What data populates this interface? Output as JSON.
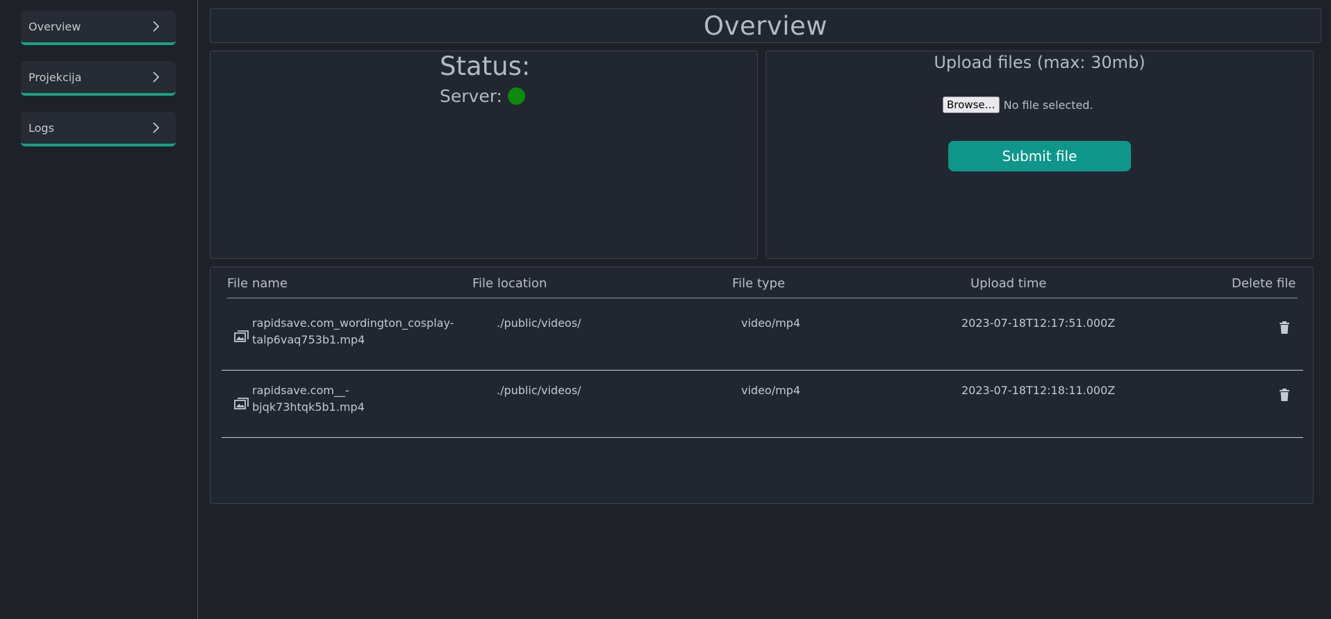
{
  "sidebar": {
    "items": [
      {
        "label": "Overview",
        "icon": "chevron-right-icon"
      },
      {
        "label": "Projekcija",
        "icon": "chevron-right-icon"
      },
      {
        "label": "Logs",
        "icon": "chevron-right-icon"
      }
    ],
    "accent_color": "#16a084"
  },
  "header": {
    "title": "Overview"
  },
  "status": {
    "heading": "Status:",
    "server_label": "Server:",
    "server_state_color": "#0b8a0b"
  },
  "upload": {
    "heading": "Upload files (max: 30mb)",
    "browse_label": "Browse…",
    "file_status": "No file selected.",
    "submit_label": "Submit file",
    "submit_color": "#0e968a"
  },
  "files": {
    "columns": [
      "File name",
      "File location",
      "File type",
      "Upload time",
      "Delete file"
    ],
    "rows": [
      {
        "name_line1": "rapidsave.com_wordington_cosplay-",
        "name_line2": "talp6vaq753b1.mp4",
        "location": "./public/videos/",
        "type": "video/mp4",
        "upload_time": "2023-07-18T12:17:51.000Z"
      },
      {
        "name_line1": "rapidsave.com__-",
        "name_line2": "bjqk73htqk5b1.mp4",
        "location": "./public/videos/",
        "type": "video/mp4",
        "upload_time": "2023-07-18T12:18:11.000Z"
      }
    ]
  }
}
